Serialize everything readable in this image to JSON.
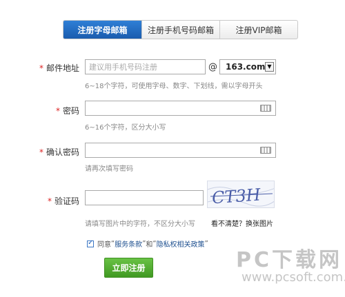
{
  "tabs": [
    {
      "label": "注册字母邮箱",
      "active": true
    },
    {
      "label": "注册手机号码邮箱",
      "active": false
    },
    {
      "label": "注册VIP邮箱",
      "active": false
    }
  ],
  "fields": {
    "email": {
      "label": "邮件地址",
      "placeholder": "建议用手机号码注册",
      "at": "@",
      "domain": "163.com",
      "hint": "6~18个字符，可使用字母、数字、下划线，需以字母开头"
    },
    "password": {
      "label": "密码",
      "hint": "6~16个字符，区分大小写"
    },
    "confirm": {
      "label": "确认密码",
      "hint": "请再次填写密码"
    },
    "captcha": {
      "label": "验证码",
      "hint": "请填写图片中的字符，不区分大小写",
      "refresh": "看不清楚？换张图片",
      "text": "CT3H"
    }
  },
  "required_mark": "*",
  "agree": {
    "checked": true,
    "prefix": "同意",
    "terms": "服务条款",
    "and": "和",
    "privacy": "隐私权相关政策"
  },
  "submit_label": "立即注册",
  "watermark": {
    "line1": "PC下载网",
    "line2": "www.pcsoft.com.cn"
  }
}
